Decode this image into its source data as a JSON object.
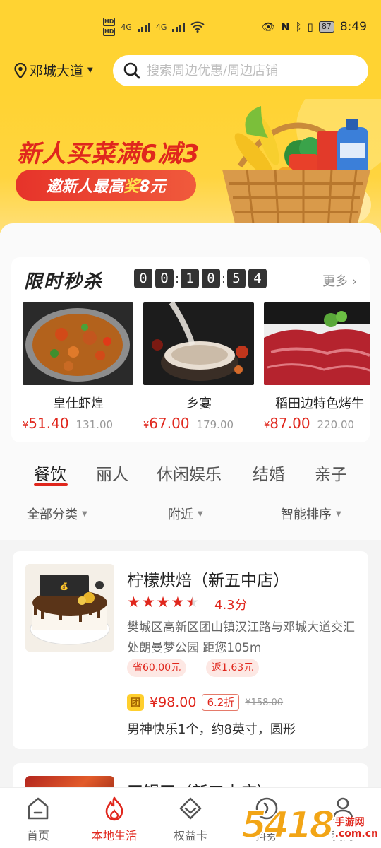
{
  "status_bar": {
    "hd1": "HD",
    "hd2": "HD",
    "net1": "4G",
    "net2": "4G",
    "battery": "87",
    "time": "8:49"
  },
  "header": {
    "location": "邓城大道",
    "search_placeholder": "搜索周边优惠/周边店铺"
  },
  "banner": {
    "title": "新人买菜满6减3",
    "pill_text": "邀新人最高",
    "pill_highlight": "奖",
    "pill_tail": "8元"
  },
  "flash_sale": {
    "title": "限时秒杀",
    "countdown": [
      "0",
      "0",
      "1",
      "0",
      "5",
      "4"
    ],
    "more": "更多",
    "items": [
      {
        "name": "皇仕虾煌",
        "currency": "¥",
        "price": "51.40",
        "old_price": "131.00"
      },
      {
        "name": "乡宴",
        "currency": "¥",
        "price": "67.00",
        "old_price": "179.00"
      },
      {
        "name": "稻田边特色烤牛",
        "currency": "¥",
        "price": "87.00",
        "old_price": "220.00"
      }
    ]
  },
  "categories": [
    "餐饮",
    "丽人",
    "休闲娱乐",
    "结婚",
    "亲子"
  ],
  "filters": [
    "全部分类",
    "附近",
    "智能排序"
  ],
  "shops": [
    {
      "name": "柠檬烘焙（新五中店）",
      "rating_stars": 4.5,
      "score": "4.3分",
      "address": "樊城区高新区团山镇汉江路与邓城大道交汇处朗曼梦公园  距您105m",
      "tags": [
        "省60.00元",
        "返1.63元"
      ],
      "deal_badge": "团",
      "deal_price": "¥98.00",
      "discount": "6.2折",
      "deal_old_price": "¥158.00",
      "deal_desc": "男神快乐1个，约8英寸，圆形"
    },
    {
      "name": "王锅王（新五中店）"
    }
  ],
  "bottom_nav": [
    {
      "label": "首页",
      "icon": "home-icon"
    },
    {
      "label": "本地生活",
      "icon": "flame-icon"
    },
    {
      "label": "权益卡",
      "icon": "diamond-icon"
    },
    {
      "label": "抖券",
      "icon": "coupon-icon"
    },
    {
      "label": "我的",
      "icon": "user-icon"
    }
  ],
  "watermark": {
    "num": "5418",
    "line1": "手游网",
    "line2": ".com.cn"
  },
  "colors": {
    "brand_yellow": "#ffd332",
    "accent_red": "#e0271d"
  }
}
